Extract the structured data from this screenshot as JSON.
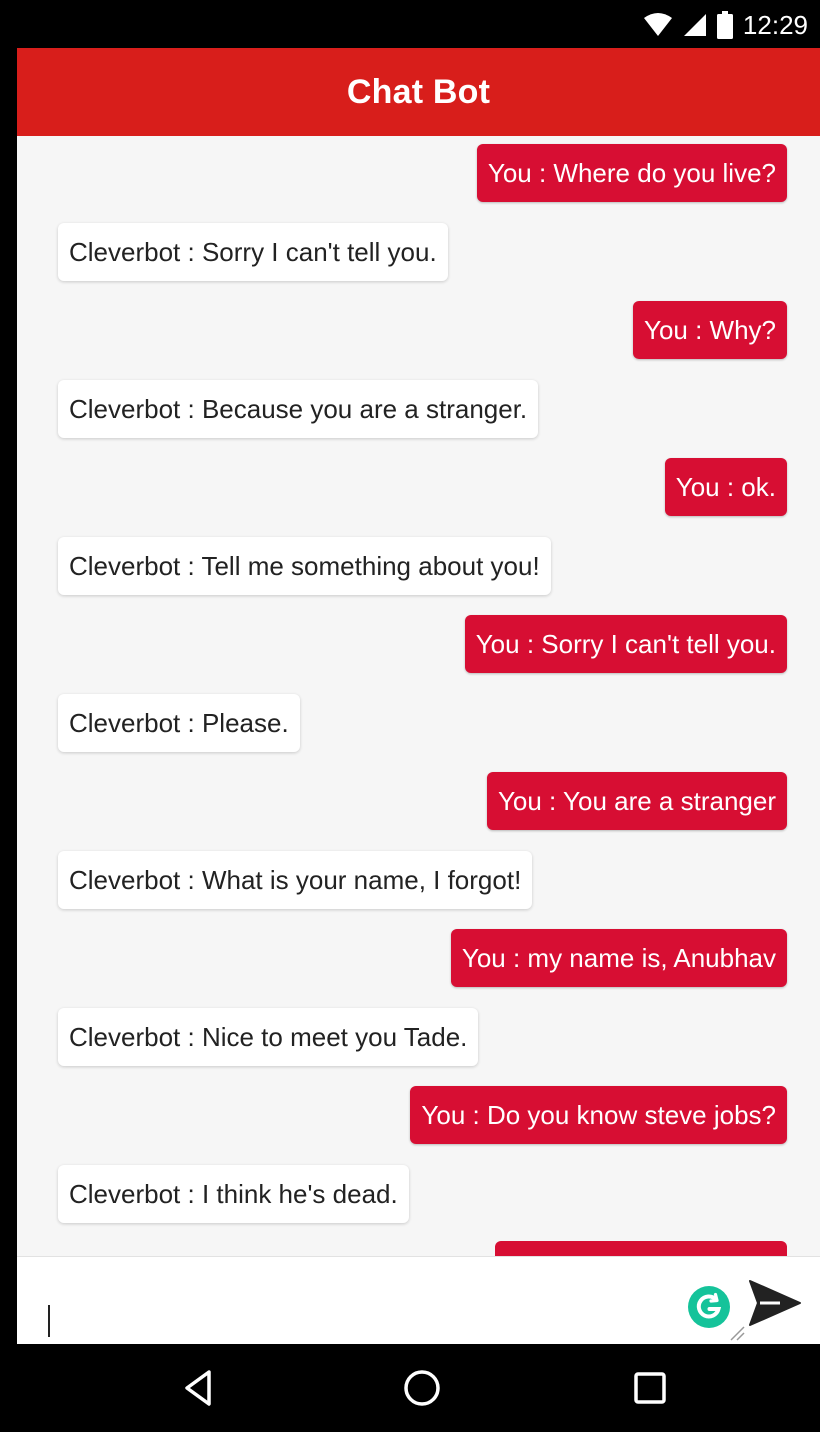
{
  "status_bar": {
    "time": "12:29",
    "icons": [
      "wifi-icon",
      "signal-icon",
      "battery-icon"
    ]
  },
  "app_bar": {
    "title": "Chat Bot",
    "color": "#d81e1b"
  },
  "chat": {
    "user_bubble_color": "#d70e33",
    "bot_bubble_color": "#ffffff",
    "messages": [
      {
        "sender": "user",
        "text": "You : Where do you live?"
      },
      {
        "sender": "bot",
        "text": "Cleverbot : Sorry I can't tell you."
      },
      {
        "sender": "user",
        "text": "You : Why?"
      },
      {
        "sender": "bot",
        "text": "Cleverbot : Because you are a stranger."
      },
      {
        "sender": "user",
        "text": "You : ok."
      },
      {
        "sender": "bot",
        "text": "Cleverbot : Tell me something about you!"
      },
      {
        "sender": "user",
        "text": "You : Sorry I can't tell you."
      },
      {
        "sender": "bot",
        "text": "Cleverbot : Please."
      },
      {
        "sender": "user",
        "text": "You : You are a stranger"
      },
      {
        "sender": "bot",
        "text": "Cleverbot : What is your name, I forgot!"
      },
      {
        "sender": "user",
        "text": "You : my name is, Anubhav"
      },
      {
        "sender": "bot",
        "text": "Cleverbot : Nice to meet you Tade."
      },
      {
        "sender": "user",
        "text": "You : Do you know steve jobs?"
      },
      {
        "sender": "bot",
        "text": "Cleverbot : I think he's dead."
      }
    ]
  },
  "input": {
    "value": "",
    "placeholder": "",
    "grammarly_color": "#15c39a",
    "send_icon": "send-icon"
  },
  "nav_bar": {
    "icons": [
      "back-icon",
      "home-icon",
      "recents-icon"
    ]
  }
}
